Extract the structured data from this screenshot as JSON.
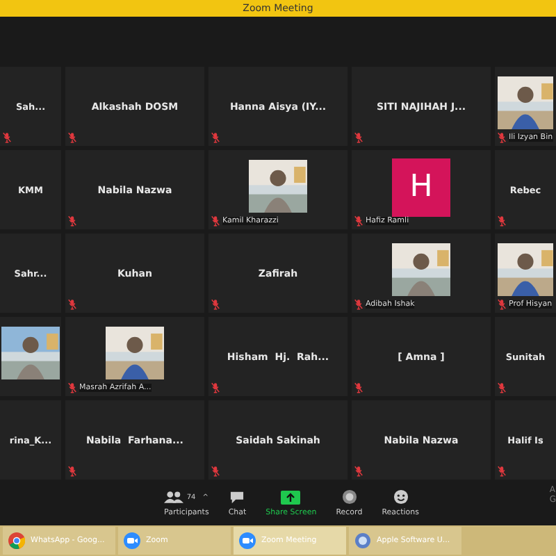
{
  "window": {
    "title": "Zoom Meeting"
  },
  "tiles": [
    {
      "kind": "name",
      "name": "Sah...",
      "muted": true
    },
    {
      "kind": "name",
      "name": "Alkashah DOSM",
      "muted": true
    },
    {
      "kind": "name",
      "name": "Hanna Aisya (IY...",
      "muted": true
    },
    {
      "kind": "name",
      "name": "SITI NAJIHAH J...",
      "muted": true
    },
    {
      "kind": "picture",
      "caption": "Ili Izyan Bin",
      "muted": true
    },
    {
      "kind": "name",
      "name": "KMM",
      "muted": false
    },
    {
      "kind": "name",
      "name": "Nabila Nazwa",
      "muted": true
    },
    {
      "kind": "picture",
      "caption": "Kamil Kharazzi",
      "muted": true
    },
    {
      "kind": "avatar",
      "initial": "H",
      "color": "#d4145a",
      "caption": "Hafiz Ramli",
      "muted": true
    },
    {
      "kind": "name",
      "name": "Rebec",
      "muted": true
    },
    {
      "kind": "name",
      "name": "Sahr...",
      "muted": false
    },
    {
      "kind": "name",
      "name": "Kuhan",
      "muted": true
    },
    {
      "kind": "name",
      "name": "Zafirah",
      "muted": true
    },
    {
      "kind": "picture",
      "caption": "Adibah Ishak",
      "muted": true
    },
    {
      "kind": "picture",
      "caption": "Prof Hisyan",
      "muted": true
    },
    {
      "kind": "picture",
      "muted": false
    },
    {
      "kind": "picture",
      "caption": "Masrah Azrifah A...",
      "muted": true
    },
    {
      "kind": "name",
      "name": "Hisham  Hj.  Rah...",
      "muted": true
    },
    {
      "kind": "name",
      "name": "[ Amna ]",
      "muted": true
    },
    {
      "kind": "name",
      "name": "Sunitah",
      "muted": true
    },
    {
      "kind": "name",
      "name": "rina_K...",
      "muted": false
    },
    {
      "kind": "name",
      "name": "Nabila  Farhana...",
      "muted": true
    },
    {
      "kind": "name",
      "name": "Saidah Sakinah",
      "muted": true
    },
    {
      "kind": "name",
      "name": "Nabila Nazwa",
      "muted": true
    },
    {
      "kind": "name",
      "name": "Halif Is",
      "muted": true
    }
  ],
  "toolbar": [
    {
      "kind": "participants",
      "label": "Participants",
      "count": "74",
      "caret": "^"
    },
    {
      "kind": "chat",
      "label": "Chat"
    },
    {
      "kind": "share",
      "label": "Share Screen"
    },
    {
      "kind": "record",
      "label": "Record"
    },
    {
      "kind": "reactions",
      "label": "Reactions"
    }
  ],
  "corner_text": [
    "A",
    "G"
  ],
  "taskbar": [
    {
      "kind": "chrome",
      "label": "WhatsApp - Goog...",
      "selected": false
    },
    {
      "kind": "zoom",
      "label": "Zoom",
      "selected": false
    },
    {
      "kind": "zoom",
      "label": "Zoom Meeting",
      "selected": true
    },
    {
      "kind": "apple",
      "label": "Apple Software U...",
      "selected": false
    }
  ]
}
